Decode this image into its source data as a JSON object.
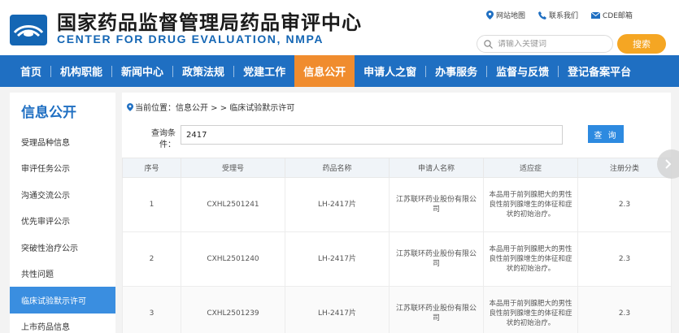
{
  "header": {
    "org_cn": "国家药品监督管理局药品审评中心",
    "org_en": "CENTER FOR DRUG EVALUATION, NMPA",
    "links": [
      "网站地图",
      "联系我们",
      "CDE邮箱"
    ],
    "search_placeholder": "请输入关键词",
    "search_button": "搜索",
    "accent": "#f5a623",
    "brand": "#1f6fc2"
  },
  "nav": {
    "items": [
      "首页",
      "机构职能",
      "新闻中心",
      "政策法规",
      "党建工作",
      "信息公开",
      "申请人之窗",
      "办事服务",
      "监督与反馈",
      "登记备案平台"
    ],
    "active_index": 5
  },
  "sidebar": {
    "title": "信息公开",
    "items": [
      "受理品种信息",
      "审评任务公示",
      "沟通交流公示",
      "优先审评公示",
      "突破性治疗公示",
      "共性问题",
      "临床试验默示许可",
      "上市药品信息"
    ],
    "active_index": 6
  },
  "breadcrumb": {
    "text": "当前位置：信息公开 > > 临床试验默示许可"
  },
  "query": {
    "label": "查询条件：",
    "value": "2417",
    "button": "查 询"
  },
  "table": {
    "headers": [
      "序号",
      "受理号",
      "药品名称",
      "申请人名称",
      "适应症",
      "注册分类"
    ],
    "rows": [
      [
        "1",
        "CXHL2501241",
        "LH-2417片",
        "江苏联环药业股份有限公司",
        "本品用于前列腺肥大的男性良性前列腺增生的体征和症状的初始治疗。",
        "2.3"
      ],
      [
        "2",
        "CXHL2501240",
        "LH-2417片",
        "江苏联环药业股份有限公司",
        "本品用于前列腺肥大的男性良性前列腺增生的体征和症状的初始治疗。",
        "2.3"
      ],
      [
        "3",
        "CXHL2501239",
        "LH-2417片",
        "江苏联环药业股份有限公司",
        "本品用于前列腺肥大的男性良性前列腺增生的体征和症状的初始治疗。",
        "2.3"
      ]
    ]
  },
  "icons": {
    "map": "location-pin-icon",
    "contact": "phone-icon",
    "mail": "mail-icon",
    "search": "search-icon",
    "next": "chevron-right-icon"
  }
}
